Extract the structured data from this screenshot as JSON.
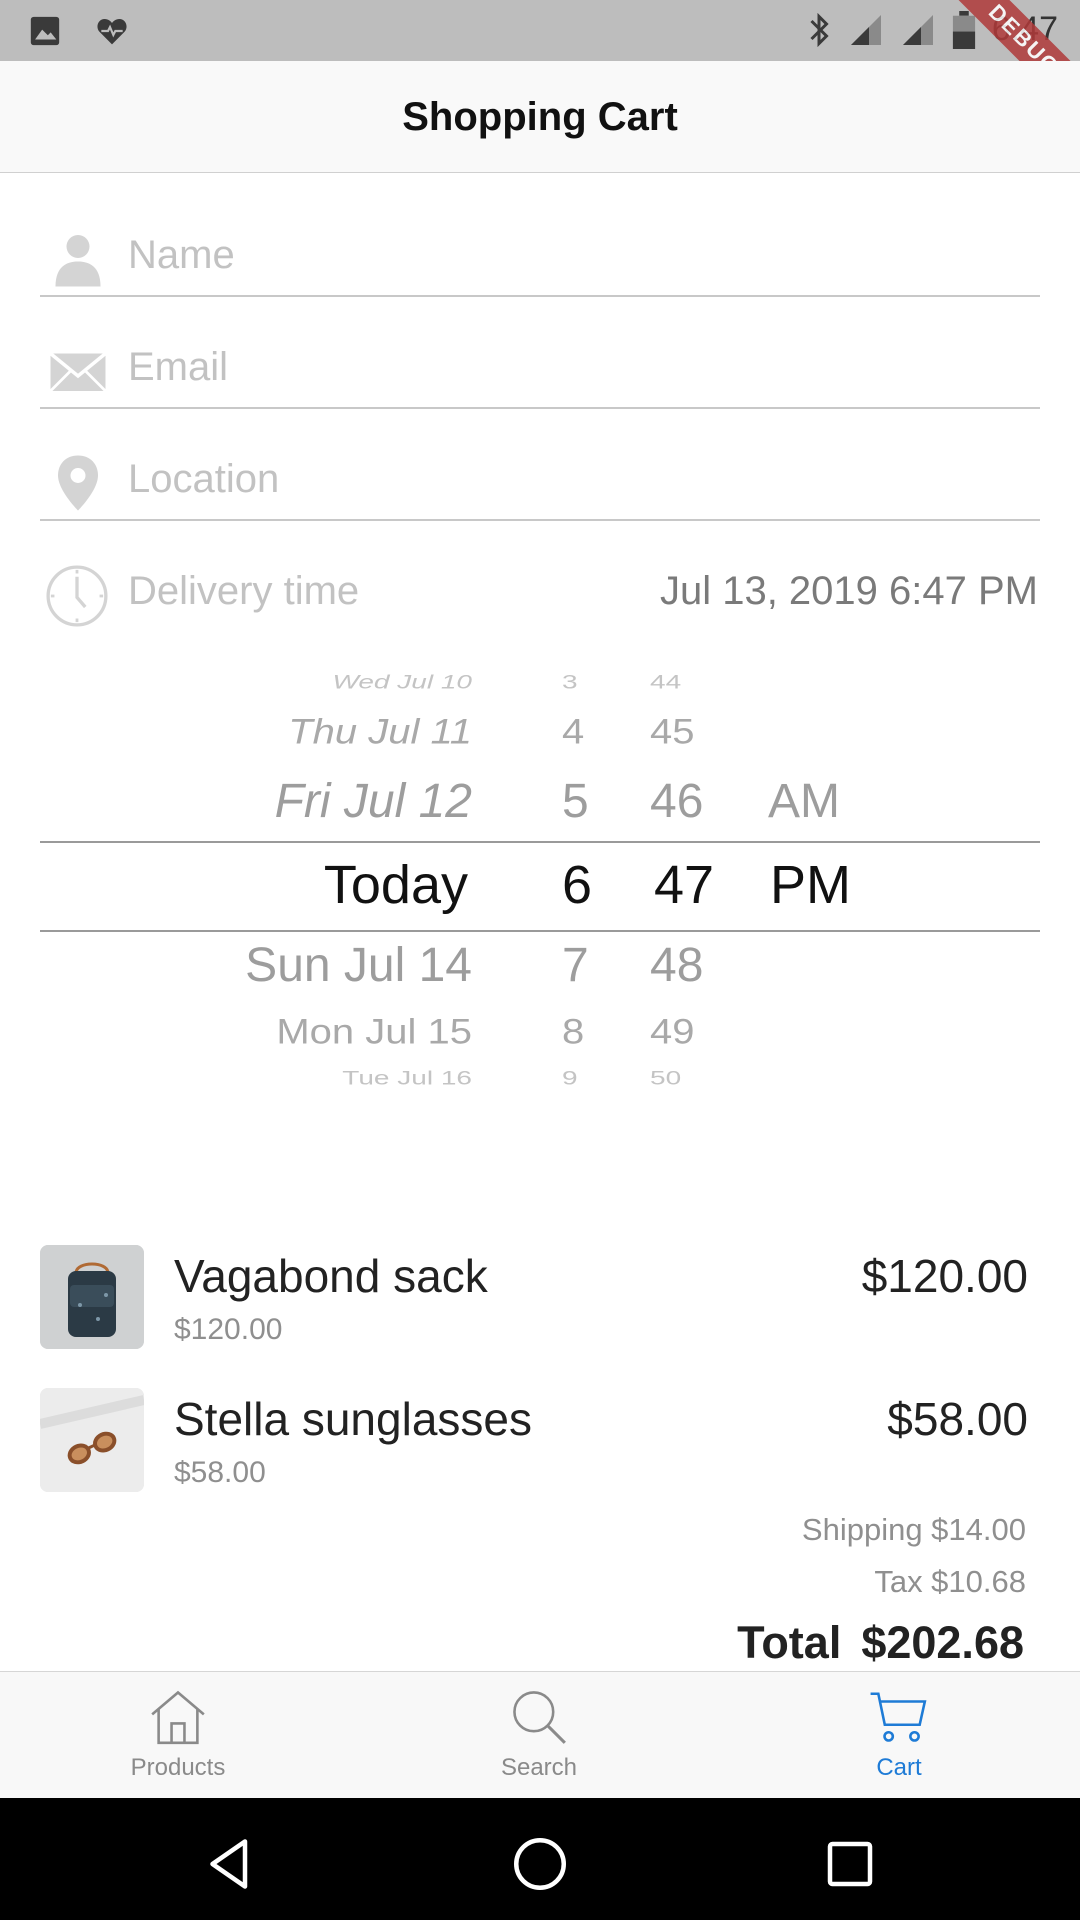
{
  "status_bar": {
    "time": "6:47",
    "left_icons": [
      "image-icon",
      "heart-pulse-icon"
    ],
    "right_icons": [
      "bluetooth-icon",
      "signal-icon",
      "signal-icon",
      "battery-icon"
    ]
  },
  "debug_banner": "DEBUG",
  "app_bar": {
    "title": "Shopping Cart"
  },
  "form": {
    "name": {
      "placeholder": "Name",
      "icon": "person-icon"
    },
    "email": {
      "placeholder": "Email",
      "icon": "mail-icon"
    },
    "location": {
      "placeholder": "Location",
      "icon": "location-pin-icon"
    },
    "delivery": {
      "label": "Delivery time",
      "value": "Jul 13, 2019 6:47 PM",
      "icon": "clock-icon"
    }
  },
  "picker": {
    "dates": [
      "Wed Jul 10",
      "Thu Jul 11",
      "Fri Jul 12",
      "Today",
      "Sun Jul 14",
      "Mon Jul 15",
      "Tue Jul 16"
    ],
    "hours": [
      "3",
      "4",
      "5",
      "6",
      "7",
      "8",
      "9"
    ],
    "minutes": [
      "44",
      "45",
      "46",
      "47",
      "48",
      "49",
      "50"
    ],
    "ampm": [
      "AM",
      "PM"
    ],
    "selected": {
      "date": "Today",
      "hour": "6",
      "minute": "47",
      "ampm": "PM"
    }
  },
  "cart": {
    "items": [
      {
        "name": "Vagabond sack",
        "unit_price": "$120.00",
        "line_total": "$120.00"
      },
      {
        "name": "Stella sunglasses",
        "unit_price": "$58.00",
        "line_total": "$58.00"
      }
    ],
    "shipping": "Shipping $14.00",
    "tax": "Tax $10.68",
    "total_label": "Total",
    "total_value": "$202.68"
  },
  "bottom_nav": {
    "items": [
      {
        "label": "Products",
        "icon": "home-icon",
        "active": false
      },
      {
        "label": "Search",
        "icon": "search-icon",
        "active": false
      },
      {
        "label": "Cart",
        "icon": "cart-icon",
        "active": true
      }
    ],
    "active_color": "#1e7bd6"
  },
  "system_nav": [
    "back-icon",
    "home-circle-icon",
    "recents-icon"
  ]
}
